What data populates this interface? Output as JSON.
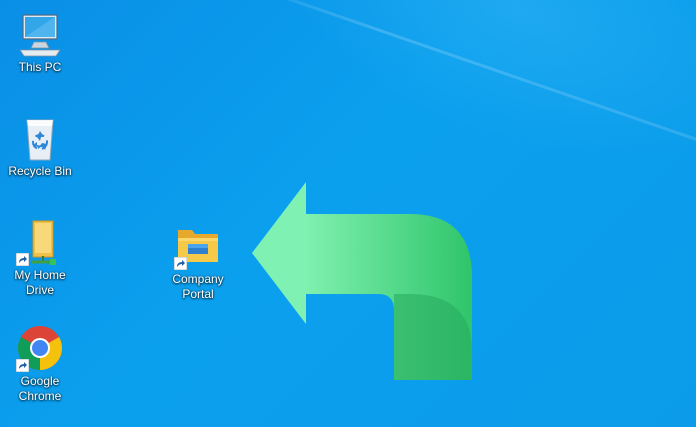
{
  "desktop": {
    "background_color": "#0b9be9",
    "icons": [
      {
        "label": "This PC",
        "icon": "computer-monitor-icon",
        "shortcut": false
      },
      {
        "label": "Recycle Bin",
        "icon": "recycle-bin-icon",
        "shortcut": false
      },
      {
        "label_lines": [
          "My Home",
          "Drive"
        ],
        "icon": "network-drive-icon",
        "shortcut": true
      },
      {
        "label_lines": [
          "Google",
          "Chrome"
        ],
        "icon": "chrome-icon",
        "shortcut": true
      },
      {
        "label_lines": [
          "Company",
          "Portal"
        ],
        "icon": "folder-icon",
        "shortcut": true
      }
    ]
  },
  "overlay": {
    "arrow_icon": "curved-arrow-left-icon",
    "arrow_color": "#3ecf76"
  }
}
